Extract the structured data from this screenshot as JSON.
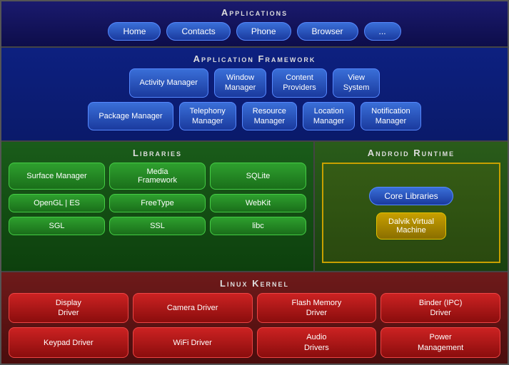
{
  "applications": {
    "title": "Applications",
    "buttons": [
      "Home",
      "Contacts",
      "Phone",
      "Browser",
      "..."
    ]
  },
  "framework": {
    "title": "Application Framework",
    "row1": [
      "Activity Manager",
      "Window Manager",
      "Content Providers",
      "View System"
    ],
    "row2": [
      "Package Manager",
      "Telephony Manager",
      "Resource Manager",
      "Location Manager",
      "Notification Manager"
    ]
  },
  "libraries": {
    "title": "Libraries",
    "items": [
      "Surface Manager",
      "Media Framework",
      "SQLite",
      "OpenGL | ES",
      "FreeType",
      "WebKit",
      "SGL",
      "SSL",
      "libc"
    ]
  },
  "runtime": {
    "title": "Android Runtime",
    "core": "Core Libraries",
    "dalvik": "Dalvik Virtual Machine"
  },
  "kernel": {
    "title": "Linux Kernel",
    "row1": [
      "Display Driver",
      "Camera Driver",
      "Flash Memory Driver",
      "Binder (IPC) Driver"
    ],
    "row2": [
      "Keypad Driver",
      "WiFi Driver",
      "Audio Drivers",
      "Power Management"
    ]
  }
}
